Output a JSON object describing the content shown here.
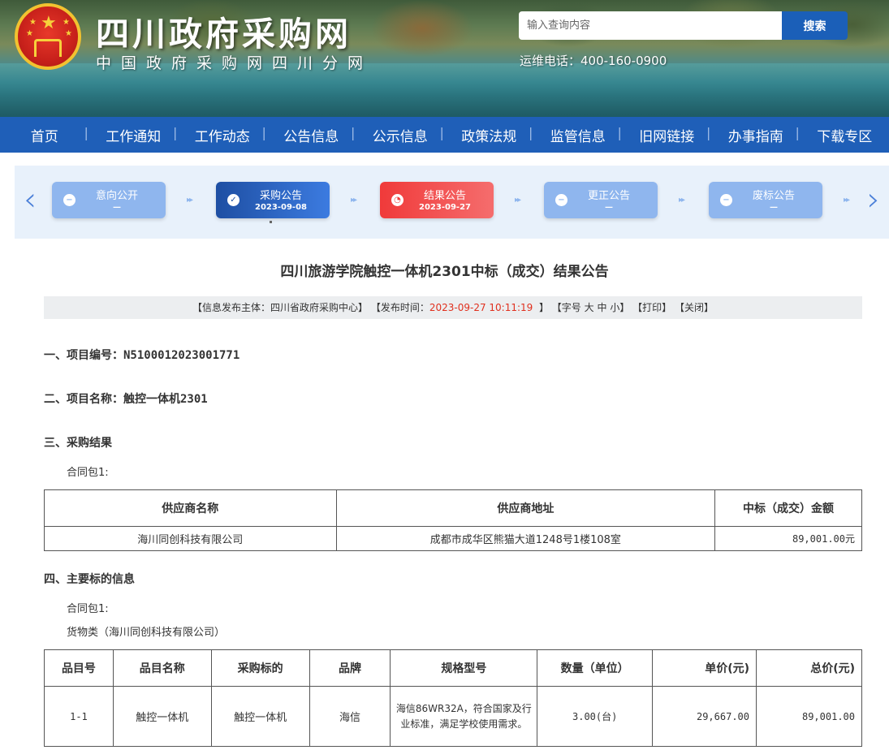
{
  "header": {
    "site_title": "四川政府采购网",
    "site_subtitle": "中国政府采购网四川分网",
    "search_placeholder": "输入查询内容",
    "search_button": "搜索",
    "hotline": "运维电话：400-160-0900"
  },
  "nav": {
    "items": [
      "首页",
      "工作通知",
      "工作动态",
      "公告信息",
      "公示信息",
      "政策法规",
      "监管信息",
      "旧网链接",
      "办事指南",
      "下载专区"
    ],
    "color": "#1f5fb8"
  },
  "progress": {
    "steps": [
      {
        "label": "意向公开",
        "date": "—",
        "state": "inactive"
      },
      {
        "label": "采购公告",
        "date": "2023-09-08",
        "state": "done"
      },
      {
        "label": "结果公告",
        "date": "2023-09-27",
        "state": "current"
      },
      {
        "label": "更正公告",
        "date": "—",
        "state": "inactive"
      },
      {
        "label": "废标公告",
        "date": "—",
        "state": "inactive"
      }
    ],
    "icons": {
      "prev": "chevron-left-icon",
      "next": "chevron-right-icon"
    }
  },
  "article": {
    "title": "四川旅游学院触控一体机2301中标（成交）结果公告",
    "meta": {
      "publisher_label": "【信息发布主体：",
      "publisher": "四川省政府采购中心】",
      "time_label": "【发布时间：",
      "time": "2023-09-27 10:11:19",
      "time_end": "】",
      "font_label": "【字号",
      "font_large": "大",
      "font_medium": "中",
      "font_small": "小】",
      "print": "【打印】",
      "close": "【关闭】"
    },
    "sections": {
      "s1_label": "一、项目编号：",
      "s1_value": "N5100012023001771",
      "s2_label": "二、项目名称：",
      "s2_value": "触控一体机2301",
      "s3_label": "三、采购结果",
      "s3_package": "合同包1:",
      "s4_label": "四、主要标的信息",
      "s4_package": "合同包1:",
      "s4_category": "货物类（海川同创科技有限公司）"
    },
    "result_table": {
      "headers": [
        "供应商名称",
        "供应商地址",
        "中标（成交）金额"
      ],
      "row": [
        "海川同创科技有限公司",
        "成都市成华区熊猫大道1248号1楼108室",
        "89,001.00元"
      ]
    },
    "items_table": {
      "headers": [
        "品目号",
        "品目名称",
        "采购标的",
        "品牌",
        "规格型号",
        "数量（单位）",
        "单价(元)",
        "总价(元)"
      ],
      "row": [
        "1-1",
        "触控一体机",
        "触控一体机",
        "海信",
        "海信86WR32A，符合国家及行业标准，满足学校使用需求。",
        "3.00(台)",
        "29,667.00",
        "89,001.00"
      ]
    }
  }
}
